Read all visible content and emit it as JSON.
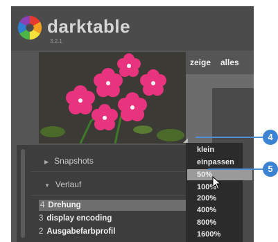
{
  "app": {
    "name": "darktable",
    "version": "3.2.1"
  },
  "toolbar": {
    "zoom_label": "zeige",
    "all_label": "alles"
  },
  "modules": {
    "snapshots_label": "Snapshots",
    "history_label": "Verlauf",
    "history_items": [
      {
        "num": "4",
        "label": "Drehung",
        "selected": true
      },
      {
        "num": "3",
        "label": "display encoding",
        "selected": false
      },
      {
        "num": "2",
        "label": "Ausgabefarbprofil",
        "selected": false
      }
    ]
  },
  "zoom_menu": {
    "options": [
      "klein",
      "einpassen",
      "50%",
      "100%",
      "200%",
      "400%",
      "800%",
      "1600%"
    ],
    "hovered": "50%"
  },
  "callouts": [
    {
      "number": "4"
    },
    {
      "number": "5"
    }
  ],
  "icons": {
    "logo": "darktable-aperture-logo-icon",
    "cursor": "mouse-pointer-icon",
    "collapse": "triangle-right-icon",
    "expand": "triangle-down-icon",
    "resize": "resize-grip-icon"
  },
  "colors": {
    "callout_blue": "#3d83d4",
    "menu_bg": "#2b2b2b",
    "selection": "#6e6e6e"
  }
}
